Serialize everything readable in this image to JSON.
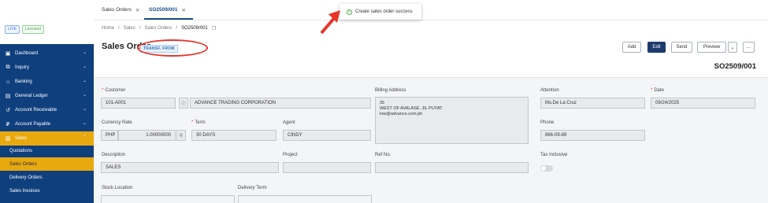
{
  "badges": {
    "live": "LIVE",
    "licensed": "Licensed"
  },
  "sidebar": {
    "items": [
      {
        "label": "Dashboard",
        "icon": "dashboard-icon"
      },
      {
        "label": "Inquiry",
        "icon": "inquiry-icon"
      },
      {
        "label": "Banking",
        "icon": "bank-icon"
      },
      {
        "label": "General Ledger",
        "icon": "ledger-icon"
      },
      {
        "label": "Account Receivable",
        "icon": "receivable-icon"
      },
      {
        "label": "Account Payable",
        "icon": "payable-icon"
      },
      {
        "label": "Sales",
        "icon": "sales-icon"
      }
    ],
    "sub_items": [
      "Quotations",
      "Sales Orders",
      "Delivery Orders",
      "Sales Invoices"
    ]
  },
  "tabs": [
    {
      "label": "Sales Orders"
    },
    {
      "label": "SO2509/001"
    }
  ],
  "toast": {
    "message": "Create sales order success"
  },
  "breadcrumb": [
    "Home",
    "Sales",
    "Sales Orders",
    "SO2509/001"
  ],
  "page": {
    "title": "Sales Order",
    "transf_badge": "TRANSF. FROM",
    "doc_no": "SO2509/001",
    "buttons": {
      "add": "Add",
      "edit": "Edit",
      "send": "Send",
      "preview": "Preview",
      "more": "..."
    }
  },
  "form": {
    "customer_label": "Customer",
    "customer_code": "101-A001",
    "customer_name": "ADVANCE TRADING CORPORATION",
    "billing_label": "Billing Address",
    "billing_lines": [
      "35",
      "WEST OF AVALASE. JIL PUYAT",
      "low@advance.com.ph"
    ],
    "attention_label": "Attention",
    "attention": "Ms.De La Cruz",
    "date_label": "Date",
    "date": "09/24/2025",
    "currency_label": "Currency Rate",
    "currency": "PHP",
    "rate": "1.00000000",
    "term_label": "Term",
    "term": "30 DAYS",
    "agent_label": "Agent",
    "agent": "CINDY",
    "phone_label": "Phone",
    "phone": "866-09-89",
    "description_label": "Description",
    "description": "SALES",
    "project_label": "Project",
    "refno_label": "Ref No.",
    "tax_label": "Tax Inclusive",
    "stock_label": "Stock Location",
    "delivery_term_label": "Delivery Term"
  }
}
